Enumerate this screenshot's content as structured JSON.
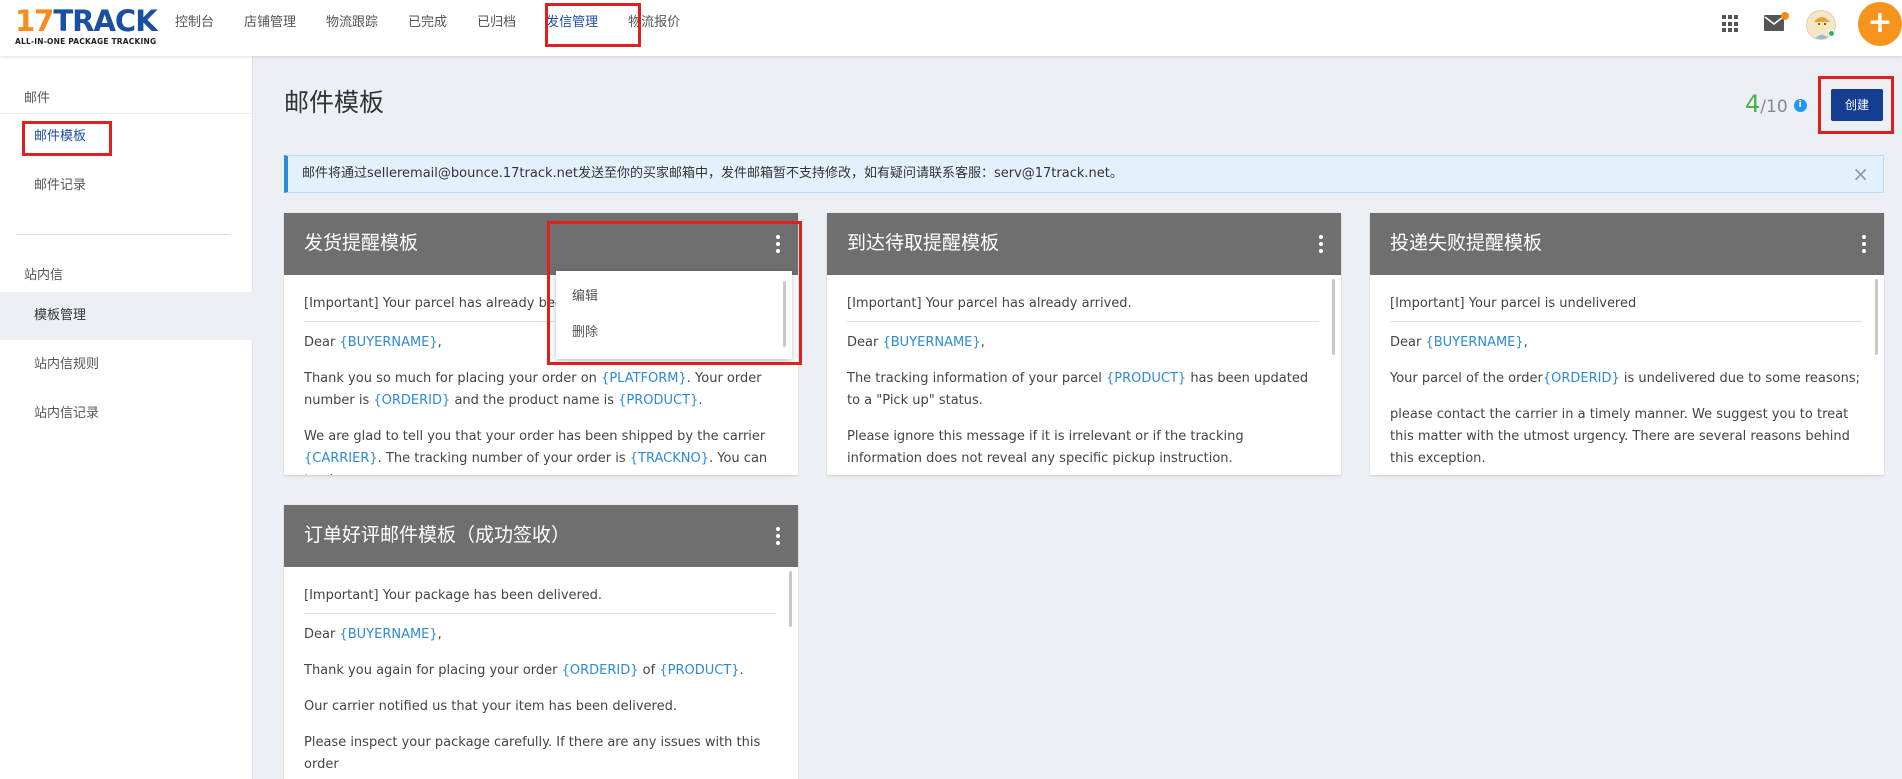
{
  "logo": {
    "main_prefix": "17",
    "main_suffix": "TRACK",
    "tagline": "ALL-IN-ONE PACKAGE TRACKING"
  },
  "nav": {
    "items": [
      {
        "label": "控制台"
      },
      {
        "label": "店铺管理"
      },
      {
        "label": "物流跟踪"
      },
      {
        "label": "已完成"
      },
      {
        "label": "已归档"
      },
      {
        "label": "发信管理",
        "active": true
      },
      {
        "label": "物流报价"
      }
    ]
  },
  "header_icons": {
    "apps": "apps-grid-icon",
    "mail": "mail-icon",
    "avatar": "avatar",
    "add": "+"
  },
  "sidebar": {
    "section_mail": "邮件",
    "mail_template": "邮件模板",
    "mail_record": "邮件记录",
    "section_site": "站内信",
    "template_mgmt": "模板管理",
    "site_rules": "站内信规则",
    "site_record": "站内信记录"
  },
  "page": {
    "title": "邮件模板",
    "quota_used": "4",
    "quota_total": "/10",
    "create_label": "创建",
    "notice": "邮件将通过selleremail@bounce.17track.net发送至你的买家邮箱中，发件邮箱暂不支持修改，如有疑问请联系客服：serv@17track.net。"
  },
  "cards": [
    {
      "title": "发货提醒模板",
      "subject": "[Important] Your parcel has already been shipped.",
      "dear": "Dear ",
      "var_buyer": "{BUYERNAME}",
      "p1a": "Thank you so much for placing your order on ",
      "p1v1": "{PLATFORM}",
      "p1b": ". Your order number is ",
      "p1v2": "{ORDERID}",
      "p1c": " and the product name is ",
      "p1v3": "{PRODUCT}",
      "p1d": ".",
      "p2a": "We are glad to tell you that your order has been shipped by the carrier ",
      "p2v1": "{CARRIER}",
      "p2b": ". The tracking number of your order is ",
      "p2v2": "{TRACKNO}",
      "p2c": ". You can track"
    },
    {
      "title": "到达待取提醒模板",
      "subject": "[Important] Your parcel has already arrived.",
      "dear": "Dear ",
      "var_buyer": "{BUYERNAME}",
      "p1a": "The tracking information of your parcel ",
      "p1v1": "{PRODUCT}",
      "p1b": " has been updated to a \"Pick up\" status.",
      "p2a": "Please ignore this message if it is irrelevant or if the tracking information does not reveal any specific pickup instruction."
    },
    {
      "title": "投递失败提醒模板",
      "subject": "[Important] Your parcel is undelivered",
      "dear": "Dear ",
      "var_buyer": "{BUYERNAME}",
      "p1a": "Your parcel of the order",
      "p1v1": "{ORDERID}",
      "p1b": " is undelivered due to some reasons;",
      "p2a": "please contact the carrier in a timely manner. We suggest you to treat this matter with the utmost urgency. There are several reasons behind this exception."
    },
    {
      "title": "订单好评邮件模板（成功签收）",
      "subject": "[Important] Your package has been delivered.",
      "dear": "Dear ",
      "var_buyer": "{BUYERNAME}",
      "p1a": "Thank you again for placing your order ",
      "p1v1": "{ORDERID}",
      "p1b": " of ",
      "p1v2": "{PRODUCT}",
      "p1c": ".",
      "p2a": "Our carrier notified us that your item has been delivered.",
      "p3a": "Please inspect your package carefully. If there are any issues with this order"
    }
  ],
  "dropdown": {
    "edit": "编辑",
    "delete": "删除"
  },
  "colors": {
    "brand_blue": "#1a4fa3",
    "accent_orange": "#f7941d",
    "highlight_red": "#e02020",
    "card_header": "#6f6f6f",
    "variable_blue": "#2e8ad8"
  }
}
